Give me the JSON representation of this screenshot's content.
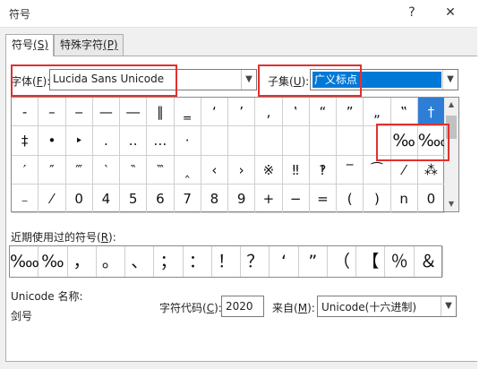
{
  "window": {
    "title": "符号",
    "help": "?",
    "close": "✕"
  },
  "tabs": [
    {
      "label": "符号",
      "key": "S",
      "key_text": "(S)"
    },
    {
      "label": "特殊字符",
      "key": "P",
      "key_text": "(P)"
    }
  ],
  "font": {
    "label": "字体",
    "key_text": "F",
    "value": "Lucida Sans Unicode"
  },
  "subset": {
    "label": "子集",
    "key_text": "U",
    "value": "广义标点"
  },
  "grid": {
    "rows": [
      [
        "‐",
        "–",
        "‒",
        "—",
        "―",
        "‖",
        "‗",
        "‘",
        "’",
        "‚",
        "‛",
        "“",
        "”",
        "„",
        "‟",
        "†"
      ],
      [
        "‡",
        "•",
        "‣",
        "․",
        "‥",
        "…",
        "‧",
        "",
        "",
        "",
        "",
        "",
        "",
        "",
        "‰",
        "‱"
      ],
      [
        "′",
        "″",
        "‴",
        "‵",
        "‶",
        "‷",
        "‸",
        "‹",
        "›",
        "※",
        "‼",
        "‽",
        "‾",
        "⁀",
        "⁄",
        "⁂"
      ],
      [
        "₋",
        "⁄",
        "0",
        "4",
        "5",
        "6",
        "7",
        "8",
        "9",
        "+",
        "−",
        "=",
        "(",
        ")",
        "n",
        "0"
      ]
    ]
  },
  "recent": {
    "label": "近期使用过的符号",
    "key_text": "R",
    "symbols": [
      "‱",
      "‰",
      "，",
      "。",
      "、",
      "；",
      "：",
      "！",
      "？",
      "‘",
      "”",
      "（",
      "【",
      "％",
      "＆"
    ]
  },
  "unicode_name": {
    "label": "Unicode 名称:",
    "value": "剑号"
  },
  "char_code": {
    "label": "字符代码",
    "key_text": "C",
    "value": "2020"
  },
  "from": {
    "label": "来自",
    "key_text": "M",
    "value": "Unicode(十六进制)"
  }
}
